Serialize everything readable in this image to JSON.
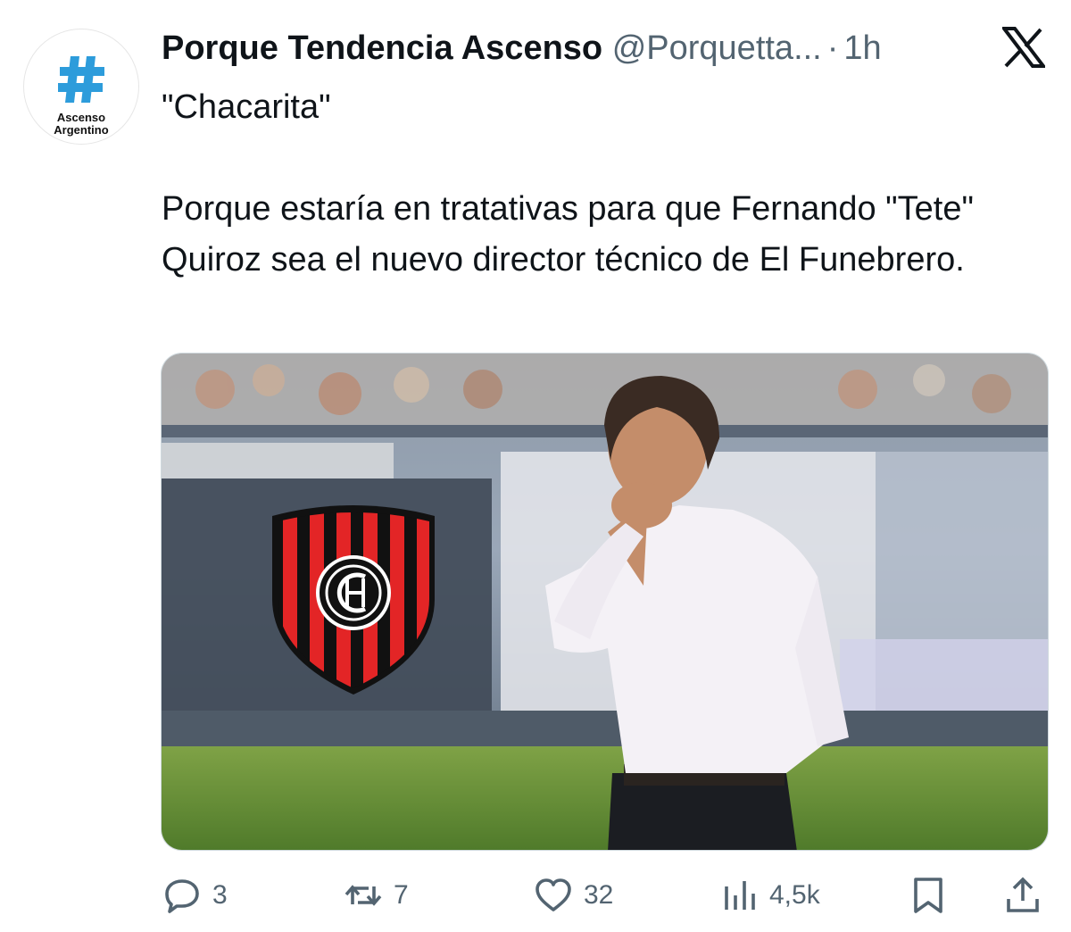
{
  "avatar": {
    "line1": "Ascenso",
    "line2": "Argentino",
    "accent": "#2d9cdb"
  },
  "header": {
    "display_name": "Porque Tendencia Ascenso",
    "handle": "@Porquetta...",
    "separator": "·",
    "time": "1h"
  },
  "tweet": {
    "line1": "\"Chacarita\"",
    "line2": "Porque estaría en tratativas para que Fernando \"Tete\" Quiroz sea el nuevo director técnico de El Funebrero."
  },
  "media": {
    "crest_colors": {
      "red": "#e32526",
      "black": "#111111",
      "white": "#ffffff"
    }
  },
  "actions": {
    "replies": "3",
    "reposts": "7",
    "likes": "32",
    "views": "4,5k"
  },
  "icons": [
    "hashtag-icon",
    "x-logo-icon",
    "reply-icon",
    "repost-icon",
    "like-icon",
    "views-icon",
    "bookmark-icon",
    "share-icon"
  ],
  "colors": {
    "text": "#0f1419",
    "secondary": "#536471",
    "border": "#cfd9de"
  }
}
